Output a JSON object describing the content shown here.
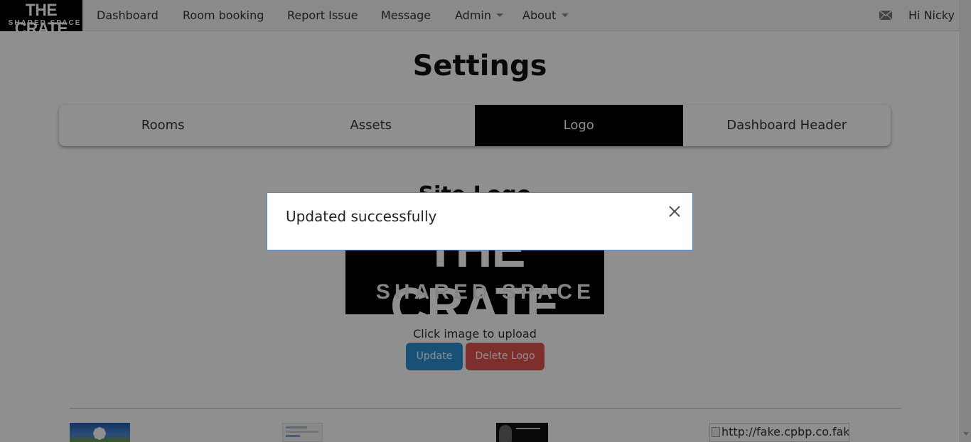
{
  "navbar": {
    "brand_line1": "THE CRATE",
    "brand_line2": "SHARED SPACE",
    "items": [
      {
        "label": "Dashboard"
      },
      {
        "label": "Room booking"
      },
      {
        "label": "Report Issue"
      },
      {
        "label": "Message"
      },
      {
        "label": "Admin",
        "dropdown": true
      },
      {
        "label": "About",
        "dropdown": true
      }
    ],
    "mail_icon": "envelope-icon",
    "greeting": "Hi Nicky"
  },
  "page": {
    "title": "Settings",
    "tabs": [
      {
        "label": "Rooms",
        "active": false
      },
      {
        "label": "Assets",
        "active": false
      },
      {
        "label": "Logo",
        "active": true
      },
      {
        "label": "Dashboard Header",
        "active": false
      }
    ],
    "section_title": "Site Logo",
    "logo_line1": "THE CRATE",
    "logo_line2": "SHARED SPACE",
    "upload_hint": "Click image to upload",
    "update_button": "Update",
    "delete_button": "Delete Logo",
    "gallery": [
      {
        "type": "image",
        "subject": "daisy-photo"
      },
      {
        "type": "image",
        "subject": "screenshot-thumbnail"
      },
      {
        "type": "image",
        "subject": "portrait-thumbnail"
      },
      {
        "type": "broken-image",
        "alt": "http://fake.cpbp.co.fake"
      }
    ]
  },
  "modal": {
    "message": "Updated successfully",
    "close_icon": "close-icon"
  },
  "colors": {
    "update_button": "#2e8fd6",
    "delete_button": "#e0554d",
    "active_tab": "#000000",
    "modal_border": "#5b87c7"
  }
}
